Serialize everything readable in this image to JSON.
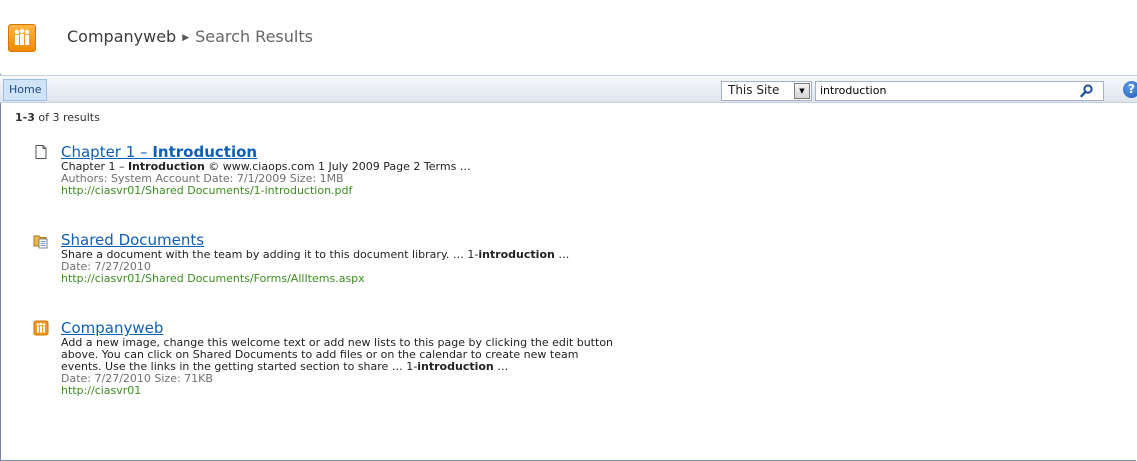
{
  "header": {
    "site_name": "Companyweb",
    "current_page": "Search Results"
  },
  "nav": {
    "home_tab": "Home"
  },
  "search": {
    "scope": "This Site",
    "query": "introduction"
  },
  "results_summary": {
    "range": "1-3",
    "total_text": "of 3 results"
  },
  "results": [
    {
      "icon": "document-icon",
      "title_prefix": "Chapter 1 – ",
      "title_bold": "Introduction",
      "snippet_1": "Chapter 1 – ",
      "snippet_bold": "Introduction",
      "snippet_2": " © www.ciaops.com 1 July 2009 Page 2 Terms …",
      "meta": "Authors: System Account   Date: 7/1/2009   Size: 1MB",
      "url": "http://ciasvr01/Shared Documents/1-introduction.pdf"
    },
    {
      "icon": "document-library-icon",
      "title": "Shared Documents",
      "snippet_1": "Share a document with the team by adding it to this document library. … 1-",
      "snippet_bold": "introduction",
      "snippet_2": " …",
      "meta": "Date: 7/27/2010",
      "url": "http://ciasvr01/Shared Documents/Forms/AllItems.aspx"
    },
    {
      "icon": "site-icon",
      "title": "Companyweb",
      "snippet_line1": "Add a new image, change this welcome text or add new lists to this page by clicking the edit button",
      "snippet_line2": "above. You can click on Shared Documents to add files or on the calendar to create new team",
      "snippet_line3_1": "events. Use the links in the getting started section to share … 1-",
      "snippet_bold": "introduction",
      "snippet_line3_2": " …",
      "meta": "Date: 7/27/2010   Size: 71KB",
      "url": "http://ciasvr01"
    }
  ]
}
